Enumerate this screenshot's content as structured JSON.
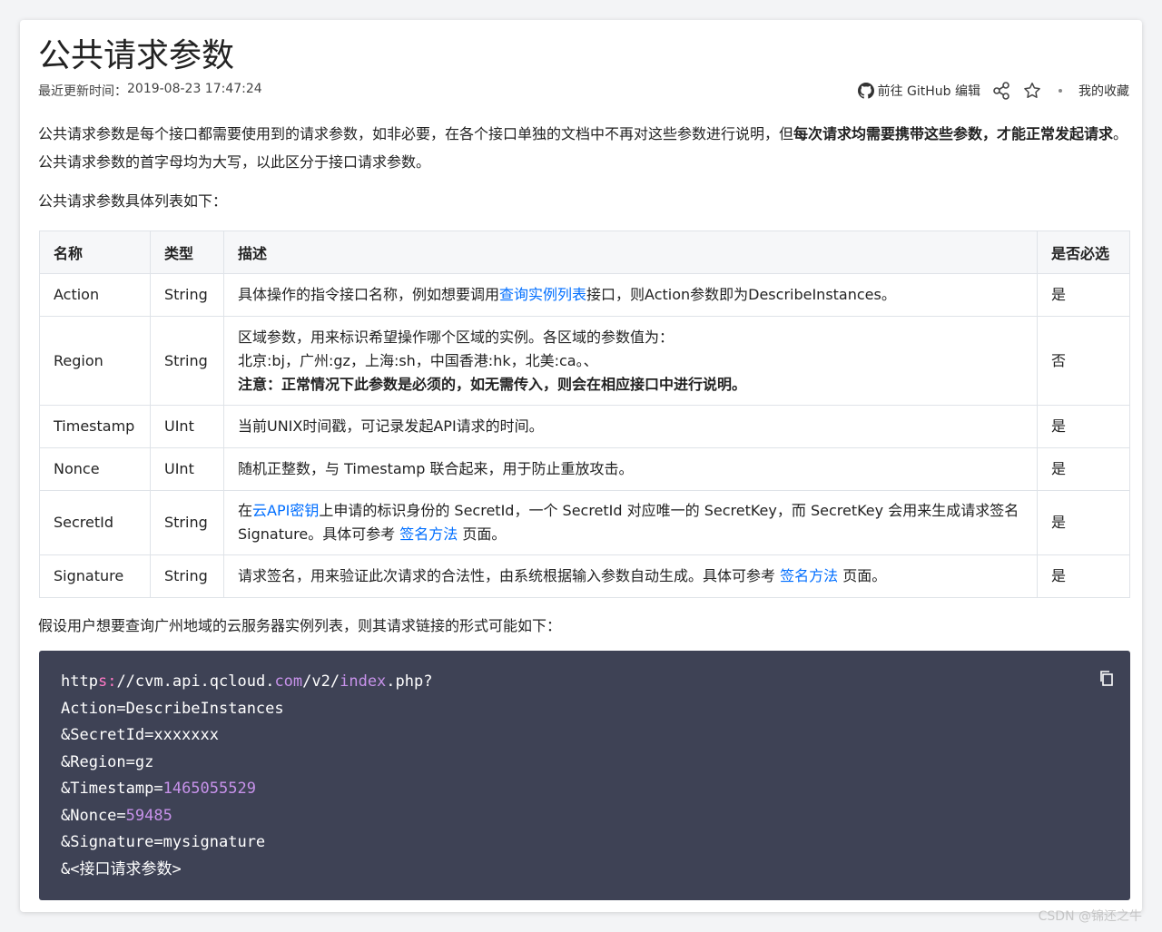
{
  "doc": {
    "title": "公共请求参数",
    "updated_label": "最近更新时间：",
    "updated_time": "2019-08-23 17:47:24",
    "github_label": "前往 GitHub 编辑",
    "favorite_label": "我的收藏"
  },
  "intro": {
    "p1_a": "公共请求参数是每个接口都需要使用到的请求参数，如非必要，在各个接口单独的文档中不再对这些参数进行说明，但",
    "p1_bold": "每次请求均需要携带这些参数，才能正常发起请求",
    "p1_b": "。公共请求参数的首字母均为大写，以此区分于接口请求参数。",
    "p2": "公共请求参数具体列表如下：",
    "p3": "假设用户想要查询广州地域的云服务器实例列表，则其请求链接的形式可能如下："
  },
  "table": {
    "headers": [
      "名称",
      "类型",
      "描述",
      "是否必选"
    ],
    "rows": {
      "action": {
        "name": "Action",
        "type": "String",
        "desc_a": "具体操作的指令接口名称，例如想要调用",
        "desc_link": "查询实例列表",
        "desc_b": "接口，则Action参数即为DescribeInstances。",
        "required": "是"
      },
      "region": {
        "name": "Region",
        "type": "String",
        "desc_l1": "区域参数，用来标识希望操作哪个区域的实例。各区域的参数值为：",
        "desc_l2": "北京:bj，广州:gz，上海:sh，中国香港:hk，北美:ca。、",
        "desc_l3": "注意：正常情况下此参数是必须的，如无需传入，则会在相应接口中进行说明。",
        "required": "否"
      },
      "timestamp": {
        "name": "Timestamp",
        "type": "UInt",
        "desc": "当前UNIX时间戳，可记录发起API请求的时间。",
        "required": "是"
      },
      "nonce": {
        "name": "Nonce",
        "type": "UInt",
        "desc": "随机正整数，与 Timestamp 联合起来，用于防止重放攻击。",
        "required": "是"
      },
      "secretid": {
        "name": "SecretId",
        "type": "String",
        "desc_a": "在",
        "desc_link1": "云API密钥",
        "desc_b": "上申请的标识身份的 SecretId，一个 SecretId 对应唯一的 SecretKey，而 SecretKey 会用来生成请求签名 Signature。具体可参考 ",
        "desc_link2": "签名方法",
        "desc_c": " 页面。",
        "required": "是"
      },
      "signature": {
        "name": "Signature",
        "type": "String",
        "desc_a": "请求签名，用来验证此次请求的合法性，由系统根据输入参数自动生成。具体可参考 ",
        "desc_link": "签名方法",
        "desc_b": " 页面。",
        "required": "是"
      }
    }
  },
  "code": {
    "l1_a": "http",
    "l1_s": "s:",
    "l1_b": "//cvm.api.qcloud.",
    "l1_com": "com",
    "l1_c": "/v2/",
    "l1_idx": "index",
    "l1_d": ".php?",
    "l2": "Action=DescribeInstances",
    "l3": "&SecretId=xxxxxxx",
    "l4": "&Region=gz",
    "l5_a": "&Timestamp=",
    "l5_num": "1465055529",
    "l6_a": "&Nonce=",
    "l6_num": "59485",
    "l7": "&Signature=mysignature",
    "l8": "&<接口请求参数>"
  },
  "watermark": "CSDN @锦还之牛"
}
